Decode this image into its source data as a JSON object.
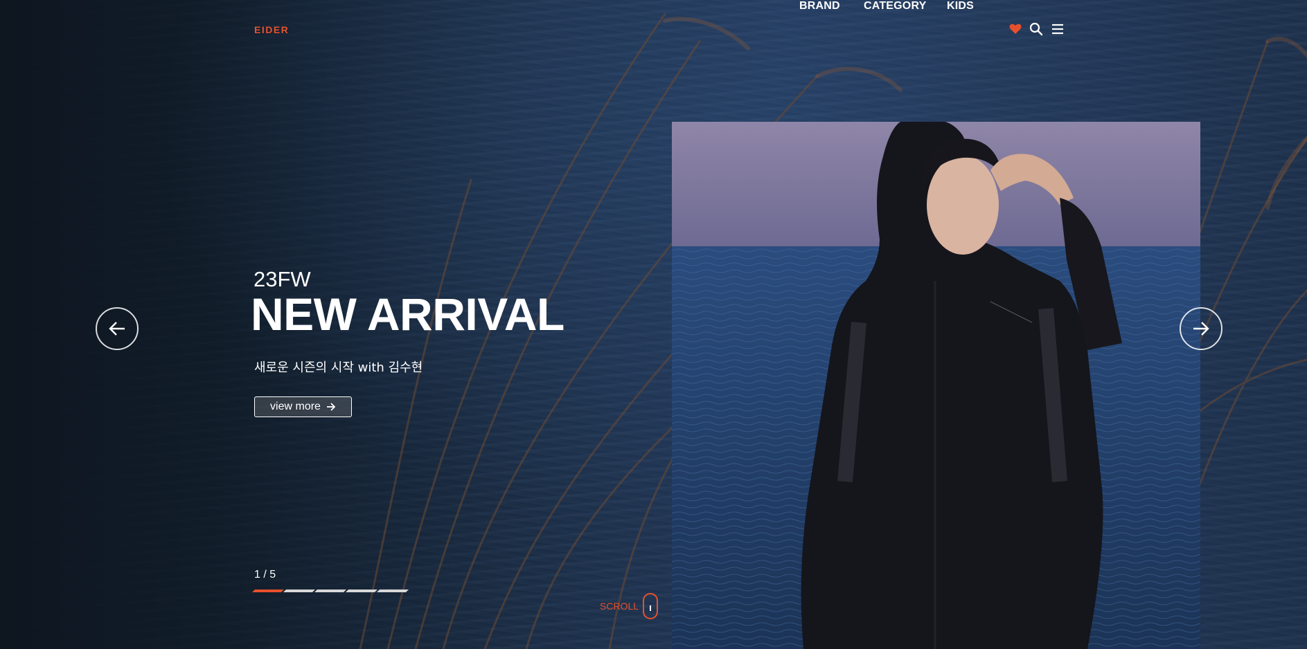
{
  "brand": {
    "logo_text": "EIDER",
    "accent_color": "#e8502c"
  },
  "nav": {
    "items": [
      {
        "label": "BRAND"
      },
      {
        "label": "CATEGORY"
      },
      {
        "label": "KIDS"
      }
    ],
    "icons": [
      "heart-icon",
      "search-icon",
      "menu-icon"
    ]
  },
  "hero": {
    "season": "23FW",
    "headline": "NEW ARRIVAL",
    "subtitle": "새로운 시즌의 시작 with 김수현",
    "cta_label": "view more"
  },
  "slider": {
    "current": 1,
    "total": 5,
    "counter_text": "1 / 5",
    "active_color": "#e8502c",
    "inactive_color": "#d8d8d8"
  },
  "scroll": {
    "label": "SCROLL"
  }
}
